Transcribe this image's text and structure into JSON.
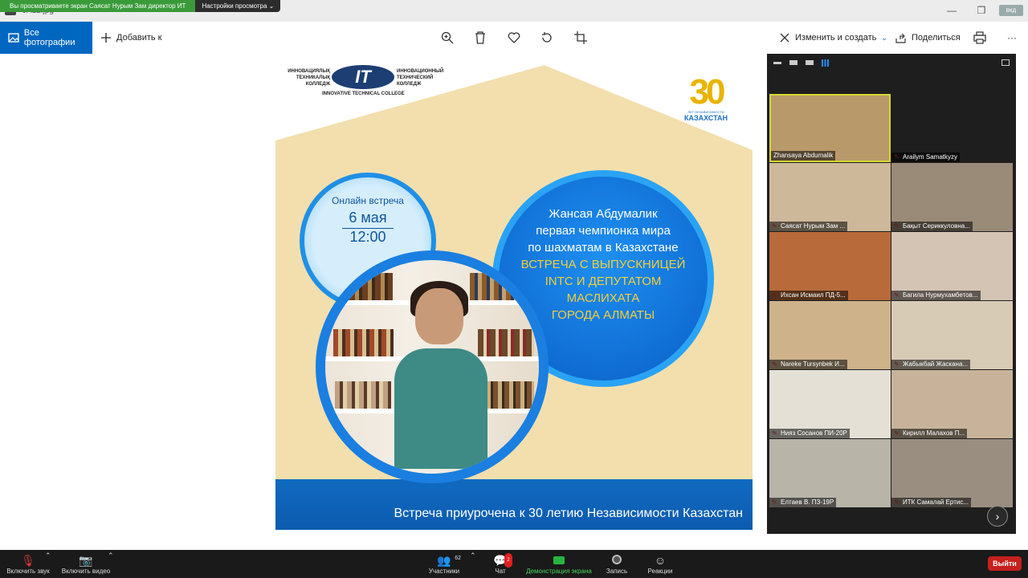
{
  "share_banner": {
    "text": "Вы просматриваете экран Саясат Нурым Зам директор ИТ",
    "settings_label": "Настройки просмотра ⌄"
  },
  "window": {
    "file_name": "JA12.jpg",
    "badge": "вкд"
  },
  "toolbar": {
    "all_photos": "Все фотографии",
    "add_to": "Добавить к",
    "edit_create": "Изменить и создать",
    "share": "Поделиться",
    "more": "···"
  },
  "poster": {
    "logo_left": "ИННОВАЦИЯЛЫҚ ТЕХНИКАЛЫҚ КОЛЛЕДЖ",
    "logo_center": "IT",
    "logo_right": "ИННОВАЦИОННЫЙ ТЕХНИЧЕСКИЙ КОЛЛЕДЖ",
    "logo_bottom": "INNOVATIVE TECHNICAL COLLEGE",
    "kz_number": "30",
    "kz_small": "ЛЕТ НЕЗАВИСИМОСТИ",
    "kz_name": "КАЗАХСТАН",
    "date_label": "Онлайн встреча",
    "date_day": "6 мая",
    "date_time": "12:00",
    "info_line1": "Жансая Абдумалик",
    "info_line2": "первая чемпионка мира",
    "info_line3": "по шахматам в Казахстане",
    "info_line4": "ВСТРЕЧА С ВЫПУСКНИЦЕЙ",
    "info_line5": "INTC И ДЕПУТАТОМ",
    "info_line6": "МАСЛИХАТА",
    "info_line7": "ГОРОДА АЛМАТЫ",
    "footer": "Встреча приурочена к 30 летию Независимости Казахстан"
  },
  "participants": [
    {
      "name": "Zhansaya Abdumalik",
      "muted": false,
      "color": "#b89a6a"
    },
    {
      "name": "Arailym Samatkyzy",
      "muted": true,
      "color": "#1e1e1e"
    },
    {
      "name": "Саясат Нурым Зам ...",
      "muted": true,
      "color": "#cdb89a"
    },
    {
      "name": "Бақыт Сериккуловна...",
      "muted": true,
      "color": "#9a8a78"
    },
    {
      "name": "Ихсан Исмаил ПД-5...",
      "muted": true,
      "color": "#b86a3a"
    },
    {
      "name": "Багила Нурмухамбетов...",
      "muted": true,
      "color": "#d4c4b4"
    },
    {
      "name": "Nareke Tursynbek И...",
      "muted": true,
      "color": "#cdb28a"
    },
    {
      "name": "Жабыкбай Жаскана...",
      "muted": true,
      "color": "#d8cbb6"
    },
    {
      "name": "Нияз Сосанов ПИ-20Р",
      "muted": true,
      "color": "#e4e0d6"
    },
    {
      "name": "Кирилл Малахов П...",
      "muted": true,
      "color": "#c8b39a"
    },
    {
      "name": "Елтаев В. ПЗ-19Р",
      "muted": true,
      "color": "#b8b4a8"
    },
    {
      "name": "ИТК Самалай Ертис...",
      "muted": true,
      "color": "#9a8e80"
    }
  ],
  "bottom": {
    "mute": "Включить звук",
    "video": "Включить видео",
    "participants": "Участники",
    "participants_count": "62",
    "chat": "Чат",
    "chat_badge": "2",
    "share_screen": "Демонстрация экрана",
    "record": "Запись",
    "reactions": "Реакции",
    "leave": "Выйти"
  },
  "colors": {
    "accent": "#0067c0",
    "share_green": "#3a9a3a",
    "leave_red": "#c6201c"
  }
}
